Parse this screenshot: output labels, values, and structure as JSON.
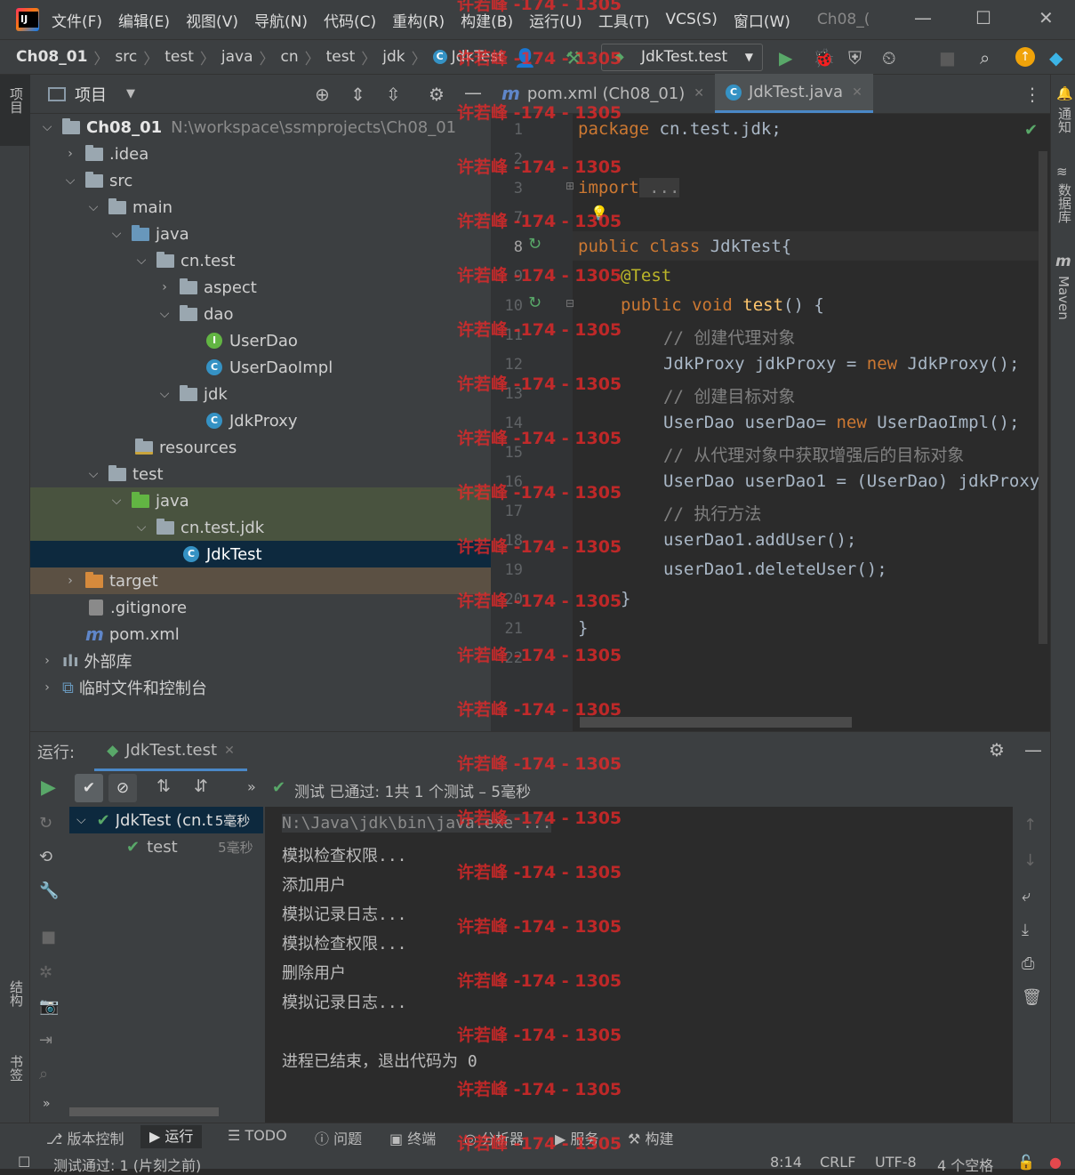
{
  "menu": {
    "items": [
      "文件(F)",
      "编辑(E)",
      "视图(V)",
      "导航(N)",
      "代码(C)",
      "重构(R)",
      "构建(B)",
      "运行(U)",
      "工具(T)",
      "VCS(S)",
      "窗口(W)"
    ],
    "window_title": "Ch08_("
  },
  "breadcrumb": {
    "items": [
      "Ch08_01",
      "src",
      "test",
      "java",
      "cn",
      "test",
      "jdk",
      "JdkTest"
    ]
  },
  "run_config": {
    "label": "JdkTest.test"
  },
  "project_panel": {
    "title": "项目",
    "tree": [
      {
        "label": "Ch08_01",
        "extra": "N:\\workspace\\ssmprojects\\Ch08_01"
      },
      {
        "label": ".idea"
      },
      {
        "label": "src"
      },
      {
        "label": "main"
      },
      {
        "label": "java"
      },
      {
        "label": "cn.test"
      },
      {
        "label": "aspect"
      },
      {
        "label": "dao"
      },
      {
        "label": "UserDao"
      },
      {
        "label": "UserDaoImpl"
      },
      {
        "label": "jdk"
      },
      {
        "label": "JdkProxy"
      },
      {
        "label": "resources"
      },
      {
        "label": "test"
      },
      {
        "label": "java"
      },
      {
        "label": "cn.test.jdk"
      },
      {
        "label": "JdkTest"
      },
      {
        "label": "target"
      },
      {
        "label": ".gitignore"
      },
      {
        "label": "pom.xml"
      },
      {
        "label": "外部库"
      },
      {
        "label": "临时文件和控制台"
      }
    ]
  },
  "editor": {
    "tabs": [
      {
        "label": "pom.xml (Ch08_01)"
      },
      {
        "label": "JdkTest.java"
      }
    ],
    "line_numbers": [
      "1",
      "2",
      "3",
      "7",
      "8",
      "9",
      "10",
      "11",
      "12",
      "13",
      "14",
      "15",
      "16",
      "17",
      "18",
      "19",
      "20",
      "21",
      "22"
    ],
    "code": {
      "l1_kw": "package",
      "l1_rest": " cn.test.jdk;",
      "l3_kw": "import",
      "l3_rest": " ...",
      "l8_kw": "public class",
      "l8_rest": " JdkTest{",
      "l9_an": "@Test",
      "l10_kw": "public void",
      "l10_fn": " test",
      "l10_rest": "() {",
      "l11": "// 创建代理对象",
      "l12_a": "JdkProxy jdkProxy = ",
      "l12_kw": "new",
      "l12_b": " JdkProxy();",
      "l13": "// 创建目标对象",
      "l14_a": "UserDao userDao= ",
      "l14_kw": "new",
      "l14_b": " UserDaoImpl();",
      "l15": "// 从代理对象中获取增强后的目标对象",
      "l16": "UserDao userDao1 = (UserDao) jdkProxy",
      "l17": "// 执行方法",
      "l18": "userDao1.addUser();",
      "l19": "userDao1.deleteUser();",
      "l20": "}",
      "l21": "}"
    }
  },
  "run_panel": {
    "label": "运行:",
    "tab": "JdkTest.test",
    "summary": "测试 已通过: 1共 1 个测试 – 5毫秒",
    "tests": [
      {
        "name": "JdkTest (cn.t",
        "time": "5毫秒"
      },
      {
        "name": "test",
        "time": "5毫秒"
      }
    ],
    "console": [
      "N:\\Java\\jdk\\bin\\java.exe ...",
      "模拟检查权限...",
      "添加用户",
      "模拟记录日志...",
      "模拟检查权限...",
      "删除用户",
      "模拟记录日志...",
      "",
      "进程已结束，退出代码为 0"
    ]
  },
  "left_strip": {
    "project": "项目",
    "structure": "结构",
    "bookmarks": "书签"
  },
  "right_strip": {
    "notifications": "通知",
    "database": "数据库",
    "maven": "Maven"
  },
  "bottom_tabs": [
    "版本控制",
    "运行",
    "TODO",
    "问题",
    "终端",
    "分析器",
    "服务",
    "构建"
  ],
  "status": {
    "message": "测试通过: 1 (片刻之前)",
    "position": "8:14",
    "line_sep": "CRLF",
    "encoding": "UTF-8",
    "indent": "4 个空格"
  },
  "watermark": "许若峰 -174 - 1305"
}
